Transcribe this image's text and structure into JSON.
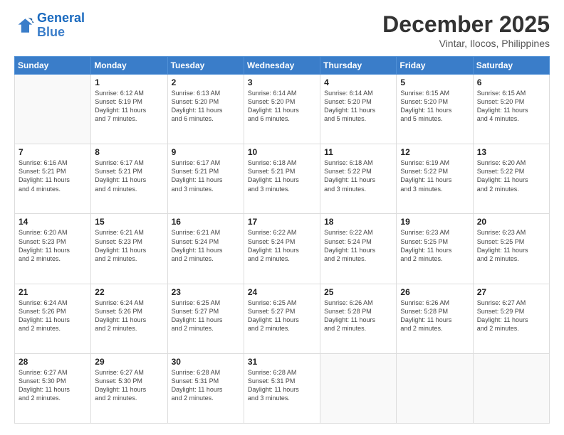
{
  "header": {
    "logo_line1": "General",
    "logo_line2": "Blue",
    "main_title": "December 2025",
    "subtitle": "Vintar, Ilocos, Philippines"
  },
  "calendar": {
    "days_of_week": [
      "Sunday",
      "Monday",
      "Tuesday",
      "Wednesday",
      "Thursday",
      "Friday",
      "Saturday"
    ],
    "weeks": [
      [
        {
          "day": "",
          "info": ""
        },
        {
          "day": "1",
          "info": "Sunrise: 6:12 AM\nSunset: 5:19 PM\nDaylight: 11 hours\nand 7 minutes."
        },
        {
          "day": "2",
          "info": "Sunrise: 6:13 AM\nSunset: 5:20 PM\nDaylight: 11 hours\nand 6 minutes."
        },
        {
          "day": "3",
          "info": "Sunrise: 6:14 AM\nSunset: 5:20 PM\nDaylight: 11 hours\nand 6 minutes."
        },
        {
          "day": "4",
          "info": "Sunrise: 6:14 AM\nSunset: 5:20 PM\nDaylight: 11 hours\nand 5 minutes."
        },
        {
          "day": "5",
          "info": "Sunrise: 6:15 AM\nSunset: 5:20 PM\nDaylight: 11 hours\nand 5 minutes."
        },
        {
          "day": "6",
          "info": "Sunrise: 6:15 AM\nSunset: 5:20 PM\nDaylight: 11 hours\nand 4 minutes."
        }
      ],
      [
        {
          "day": "7",
          "info": "Sunrise: 6:16 AM\nSunset: 5:21 PM\nDaylight: 11 hours\nand 4 minutes."
        },
        {
          "day": "8",
          "info": "Sunrise: 6:17 AM\nSunset: 5:21 PM\nDaylight: 11 hours\nand 4 minutes."
        },
        {
          "day": "9",
          "info": "Sunrise: 6:17 AM\nSunset: 5:21 PM\nDaylight: 11 hours\nand 3 minutes."
        },
        {
          "day": "10",
          "info": "Sunrise: 6:18 AM\nSunset: 5:21 PM\nDaylight: 11 hours\nand 3 minutes."
        },
        {
          "day": "11",
          "info": "Sunrise: 6:18 AM\nSunset: 5:22 PM\nDaylight: 11 hours\nand 3 minutes."
        },
        {
          "day": "12",
          "info": "Sunrise: 6:19 AM\nSunset: 5:22 PM\nDaylight: 11 hours\nand 3 minutes."
        },
        {
          "day": "13",
          "info": "Sunrise: 6:20 AM\nSunset: 5:22 PM\nDaylight: 11 hours\nand 2 minutes."
        }
      ],
      [
        {
          "day": "14",
          "info": "Sunrise: 6:20 AM\nSunset: 5:23 PM\nDaylight: 11 hours\nand 2 minutes."
        },
        {
          "day": "15",
          "info": "Sunrise: 6:21 AM\nSunset: 5:23 PM\nDaylight: 11 hours\nand 2 minutes."
        },
        {
          "day": "16",
          "info": "Sunrise: 6:21 AM\nSunset: 5:24 PM\nDaylight: 11 hours\nand 2 minutes."
        },
        {
          "day": "17",
          "info": "Sunrise: 6:22 AM\nSunset: 5:24 PM\nDaylight: 11 hours\nand 2 minutes."
        },
        {
          "day": "18",
          "info": "Sunrise: 6:22 AM\nSunset: 5:24 PM\nDaylight: 11 hours\nand 2 minutes."
        },
        {
          "day": "19",
          "info": "Sunrise: 6:23 AM\nSunset: 5:25 PM\nDaylight: 11 hours\nand 2 minutes."
        },
        {
          "day": "20",
          "info": "Sunrise: 6:23 AM\nSunset: 5:25 PM\nDaylight: 11 hours\nand 2 minutes."
        }
      ],
      [
        {
          "day": "21",
          "info": "Sunrise: 6:24 AM\nSunset: 5:26 PM\nDaylight: 11 hours\nand 2 minutes."
        },
        {
          "day": "22",
          "info": "Sunrise: 6:24 AM\nSunset: 5:26 PM\nDaylight: 11 hours\nand 2 minutes."
        },
        {
          "day": "23",
          "info": "Sunrise: 6:25 AM\nSunset: 5:27 PM\nDaylight: 11 hours\nand 2 minutes."
        },
        {
          "day": "24",
          "info": "Sunrise: 6:25 AM\nSunset: 5:27 PM\nDaylight: 11 hours\nand 2 minutes."
        },
        {
          "day": "25",
          "info": "Sunrise: 6:26 AM\nSunset: 5:28 PM\nDaylight: 11 hours\nand 2 minutes."
        },
        {
          "day": "26",
          "info": "Sunrise: 6:26 AM\nSunset: 5:28 PM\nDaylight: 11 hours\nand 2 minutes."
        },
        {
          "day": "27",
          "info": "Sunrise: 6:27 AM\nSunset: 5:29 PM\nDaylight: 11 hours\nand 2 minutes."
        }
      ],
      [
        {
          "day": "28",
          "info": "Sunrise: 6:27 AM\nSunset: 5:30 PM\nDaylight: 11 hours\nand 2 minutes."
        },
        {
          "day": "29",
          "info": "Sunrise: 6:27 AM\nSunset: 5:30 PM\nDaylight: 11 hours\nand 2 minutes."
        },
        {
          "day": "30",
          "info": "Sunrise: 6:28 AM\nSunset: 5:31 PM\nDaylight: 11 hours\nand 2 minutes."
        },
        {
          "day": "31",
          "info": "Sunrise: 6:28 AM\nSunset: 5:31 PM\nDaylight: 11 hours\nand 3 minutes."
        },
        {
          "day": "",
          "info": ""
        },
        {
          "day": "",
          "info": ""
        },
        {
          "day": "",
          "info": ""
        }
      ]
    ]
  }
}
